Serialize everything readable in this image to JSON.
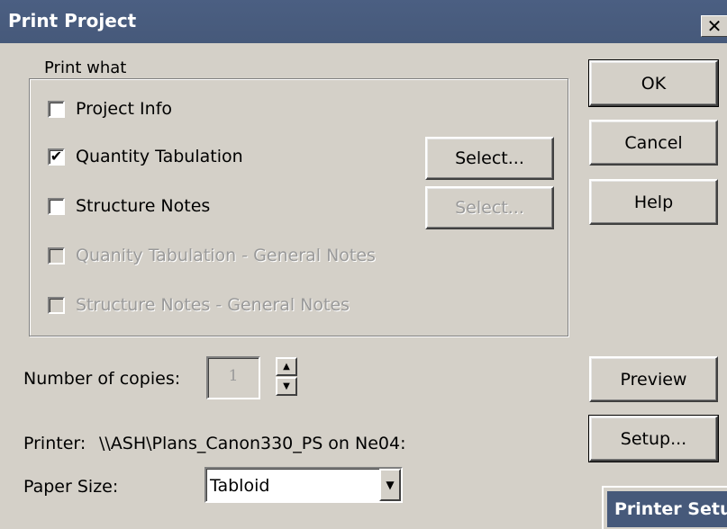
{
  "window": {
    "title": "Print Project",
    "close_glyph": "✕"
  },
  "print_what": {
    "legend": "Print what",
    "items": [
      {
        "label": "Project Info",
        "checked": false,
        "enabled": true
      },
      {
        "label": "Quantity Tabulation",
        "checked": true,
        "enabled": true
      },
      {
        "label": "Structure Notes",
        "checked": false,
        "enabled": true
      },
      {
        "label": "Quanity Tabulation - General Notes",
        "checked": false,
        "enabled": false
      },
      {
        "label": "Structure Notes - General Notes",
        "checked": false,
        "enabled": false
      }
    ],
    "select_buttons": [
      {
        "label": "Select...",
        "enabled": true
      },
      {
        "label": "Select...",
        "enabled": false
      }
    ]
  },
  "buttons": {
    "ok": "OK",
    "cancel": "Cancel",
    "help": "Help",
    "preview": "Preview",
    "setup": "Setup..."
  },
  "copies": {
    "label": "Number of copies:",
    "value": "1"
  },
  "printer": {
    "label": "Printer:",
    "name": "\\\\ASH\\Plans_Canon330_PS on Ne04:"
  },
  "paper": {
    "label": "Paper Size:",
    "value": "Tabloid"
  },
  "background_window": {
    "title": "Printer Setup"
  },
  "icons": {
    "check": "✔",
    "spin_up": "▲",
    "spin_down": "▼",
    "dropdown": "▼"
  }
}
